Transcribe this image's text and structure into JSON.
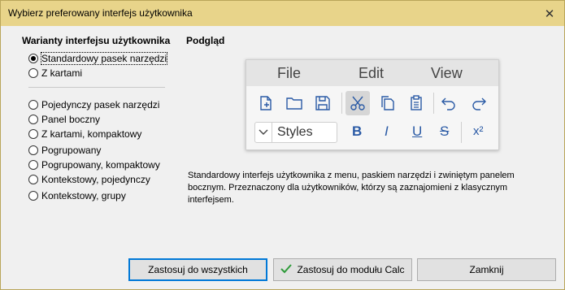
{
  "window": {
    "title": "Wybierz preferowany interfejs użytkownika",
    "close_glyph": "✕"
  },
  "variants": {
    "heading": "Warianty interfejsu użytkownika",
    "options": [
      {
        "label": "Standardowy pasek narzędzi",
        "checked": true
      },
      {
        "label": "Z kartami",
        "checked": false
      },
      {
        "label": "Pojedynczy pasek narzędzi",
        "checked": false
      },
      {
        "label": "Panel boczny",
        "checked": false
      },
      {
        "label": "Z kartami, kompaktowy",
        "checked": false
      },
      {
        "label": "Pogrupowany",
        "checked": false
      },
      {
        "label": "Pogrupowany, kompaktowy",
        "checked": false
      },
      {
        "label": "Kontekstowy, pojedynczy",
        "checked": false
      },
      {
        "label": "Kontekstowy, grupy",
        "checked": false
      }
    ]
  },
  "preview": {
    "heading": "Podgląd",
    "menu": [
      "File",
      "Edit",
      "View"
    ],
    "styles_value": "Styles",
    "format": {
      "bold": "B",
      "italic": "I",
      "underline": "U",
      "strike": "S",
      "superscript": "x²"
    },
    "icons": [
      "new-document-icon",
      "open-folder-icon",
      "save-icon",
      "cut-icon",
      "copy-icon",
      "paste-icon",
      "undo-icon",
      "redo-icon",
      "chevron-down-icon"
    ]
  },
  "description": "Standardowy interfejs użytkownika z menu, paskiem narzędzi i zwiniętym panelem bocznym. Przeznaczony dla użytkowników, którzy są zaznajomieni z klasycznym interfejsem.",
  "buttons": {
    "apply_all": "Zastosuj do wszystkich",
    "apply_calc": "Zastosuj do modułu Calc",
    "close": "Zamknij"
  },
  "colors": {
    "titlebar": "#e8d48a",
    "accent": "#2a5aa5",
    "check": "#2e9b3a"
  }
}
